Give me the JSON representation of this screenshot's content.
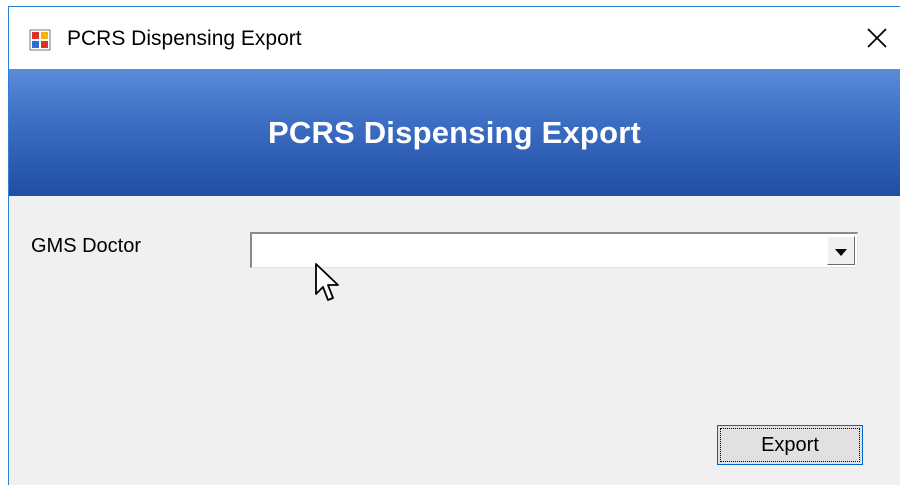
{
  "window": {
    "title": "PCRS Dispensing Export",
    "icon": "app-window-icon",
    "close_icon": "close-icon"
  },
  "banner": {
    "title": "PCRS Dispensing Export"
  },
  "form": {
    "gms_doctor_label": "GMS Doctor",
    "gms_doctor_value": "",
    "dropdown_icon": "chevron-down-icon"
  },
  "actions": {
    "export_label": "Export"
  },
  "colors": {
    "banner_top": "#5b8cd8",
    "banner_bottom": "#1f4ea3",
    "window_bg": "#f0f0f0",
    "button_focus_border": "#0066cc"
  }
}
